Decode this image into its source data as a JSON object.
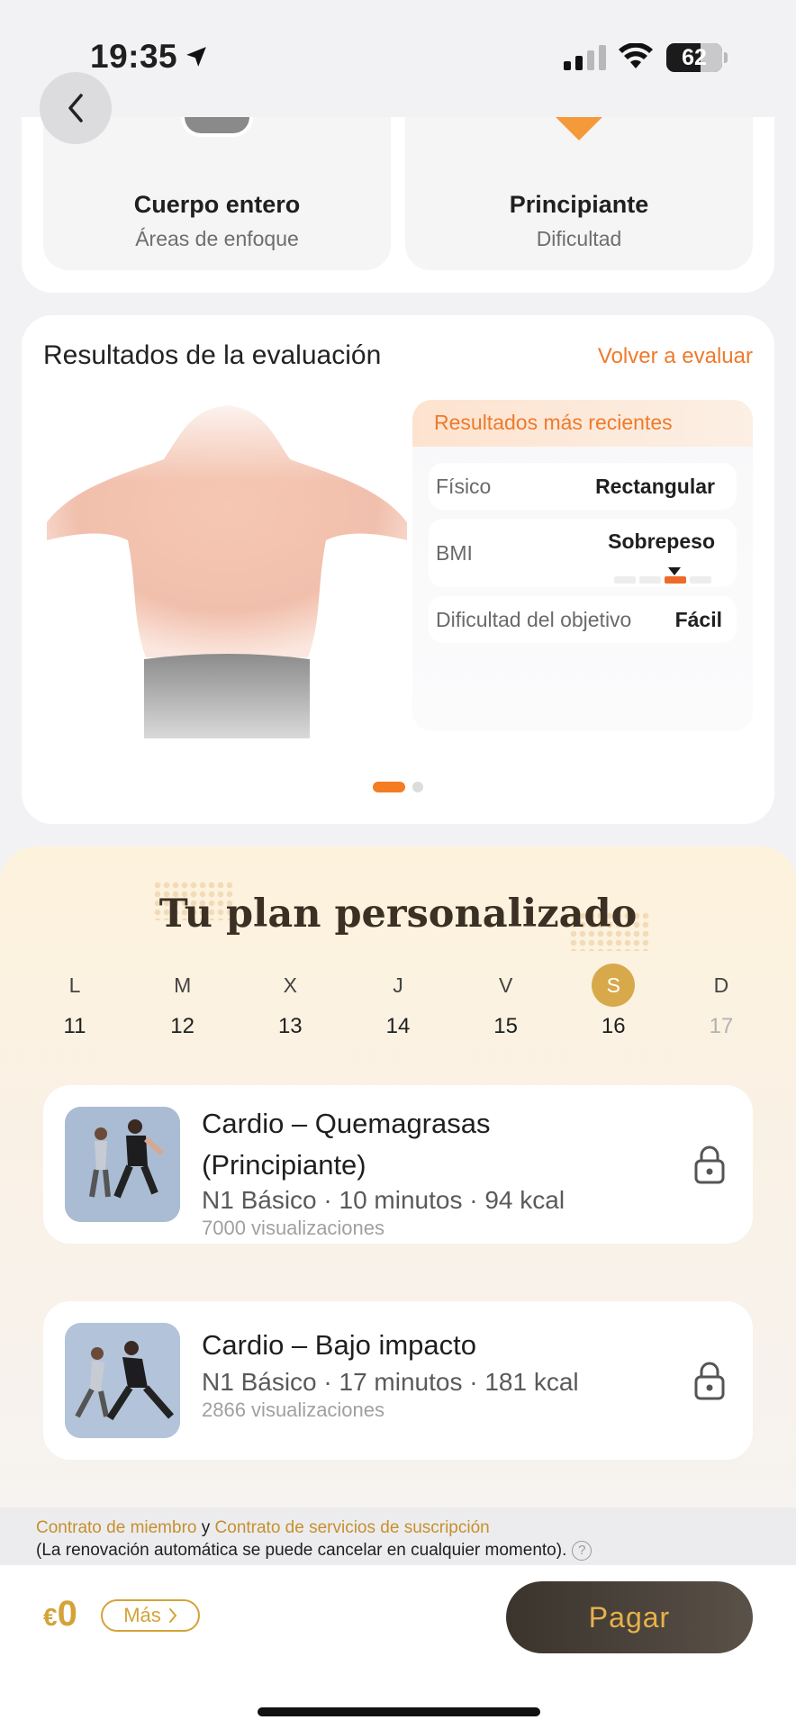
{
  "status_bar": {
    "time": "19:35",
    "battery": "62"
  },
  "top_tiles": [
    {
      "title": "Cuerpo entero",
      "subtitle": "Áreas de enfoque"
    },
    {
      "title": "Principiante",
      "subtitle": "Dificultad"
    }
  ],
  "assessment": {
    "title": "Resultados de la evaluación",
    "reevaluate": "Volver a evaluar",
    "panel_title": "Resultados más recientes",
    "rows": [
      {
        "label": "Físico",
        "value": "Rectangular"
      },
      {
        "label": "BMI",
        "value": "Sobrepeso"
      },
      {
        "label": "Dificultad del objetivo",
        "value": "Fácil"
      }
    ],
    "carousel": {
      "pages": 2,
      "active": 1
    }
  },
  "plan": {
    "title": "Tu plan personalizado",
    "days": [
      {
        "letter": "L",
        "num": "11"
      },
      {
        "letter": "M",
        "num": "12"
      },
      {
        "letter": "X",
        "num": "13"
      },
      {
        "letter": "J",
        "num": "14"
      },
      {
        "letter": "V",
        "num": "15"
      },
      {
        "letter": "S",
        "num": "16"
      },
      {
        "letter": "D",
        "num": "17"
      }
    ],
    "workouts": [
      {
        "title": "Cardio – Quemagrasas (Principiante)",
        "meta": "N1 Básico · 10 minutos · 94 kcal",
        "views": "7000 visualizaciones"
      },
      {
        "title": "Cardio – Bajo impacto",
        "meta": "N1 Básico · 17 minutos · 181 kcal",
        "views": "2866 visualizaciones"
      }
    ]
  },
  "legal": {
    "member_contract": "Contrato de miembro",
    "and": " y ",
    "subscription_contract": "Contrato de servicios de suscripción",
    "note": "(La renovación automática se puede cancelar en cualquier momento)."
  },
  "footer": {
    "currency": "€",
    "price": "0",
    "more": "Más",
    "pay": "Pagar"
  },
  "colors": {
    "accent": "#ee7a2c",
    "gold": "#d4a338",
    "pay_bg": "#3a342d"
  }
}
